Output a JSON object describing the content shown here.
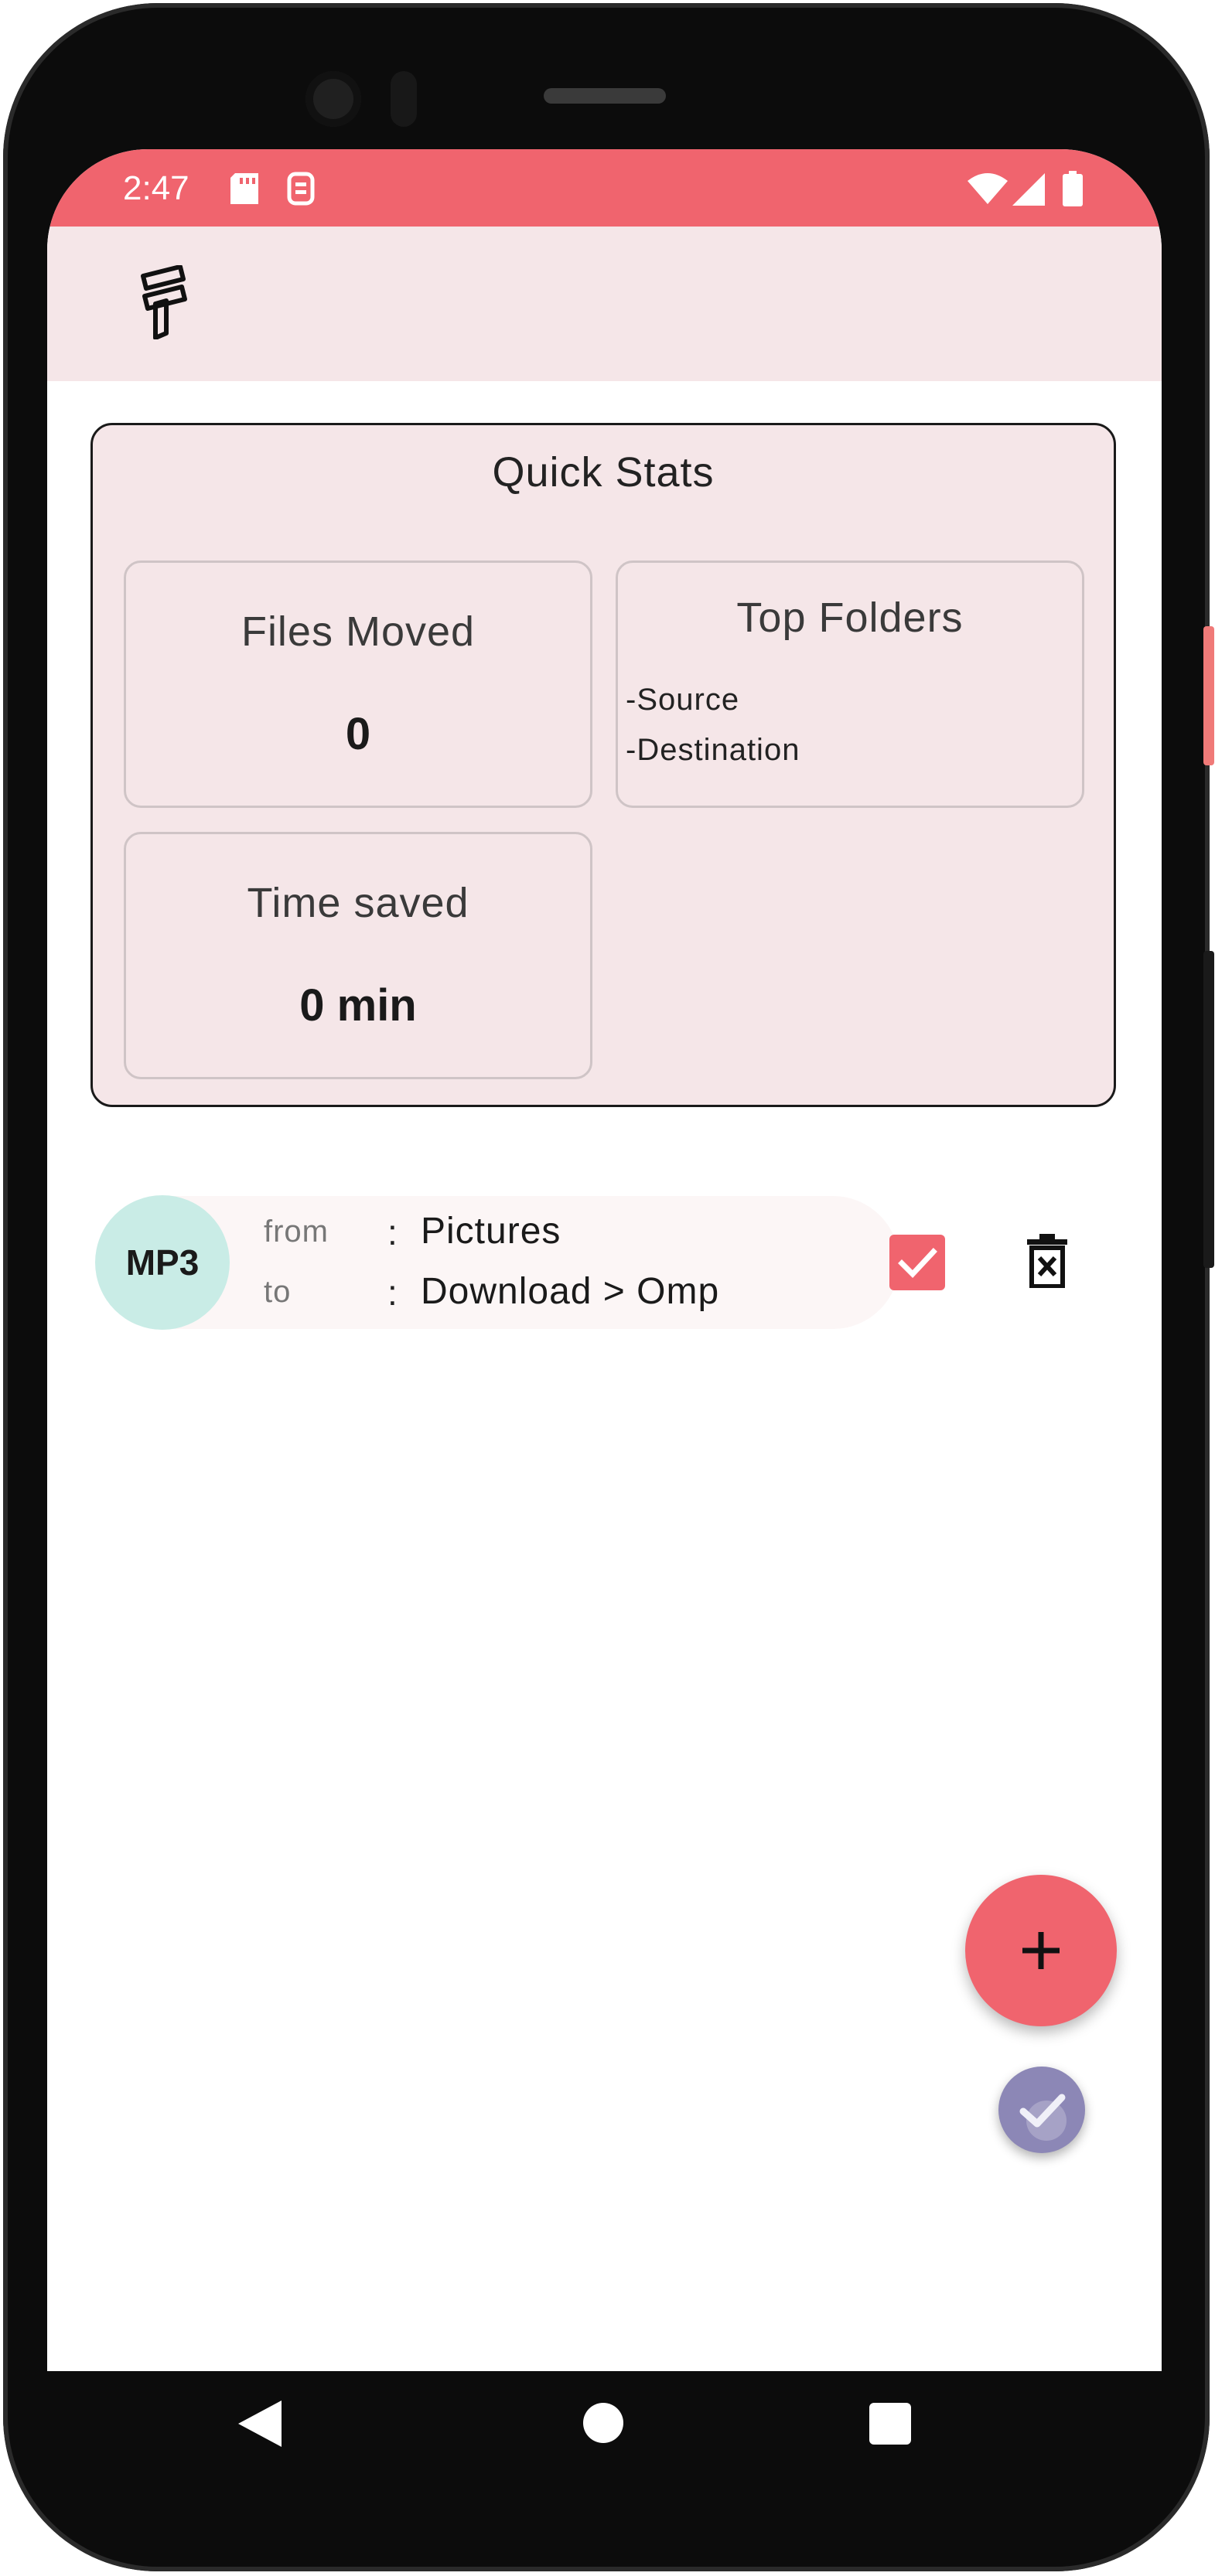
{
  "status_bar": {
    "time": "2:47",
    "icons": [
      "sd-card-icon",
      "sim-icon",
      "wifi-icon",
      "signal-icon",
      "battery-icon"
    ]
  },
  "app_bar": {
    "logo_icon": "app-logo-icon"
  },
  "quick_stats": {
    "title": "Quick Stats",
    "files_moved": {
      "label": "Files Moved",
      "value": "0"
    },
    "top_folders": {
      "label": "Top Folders",
      "lines": [
        "-Source",
        "-Destination"
      ]
    },
    "time_saved": {
      "label": "Time saved",
      "value": "0 min"
    }
  },
  "rules": [
    {
      "badge": "MP3",
      "from_label": "from",
      "to_label": "to",
      "separator": ":",
      "from_value": "Pictures",
      "to_value": "Download > Omp",
      "checked": true
    }
  ],
  "fabs": {
    "add_icon": "plus-icon",
    "confirm_icon": "check-icon"
  },
  "colors": {
    "accent": "#f0646e",
    "surface": "#f5e6e8",
    "badge": "#c9ece6",
    "secondary_fab": "#8c87b6"
  }
}
